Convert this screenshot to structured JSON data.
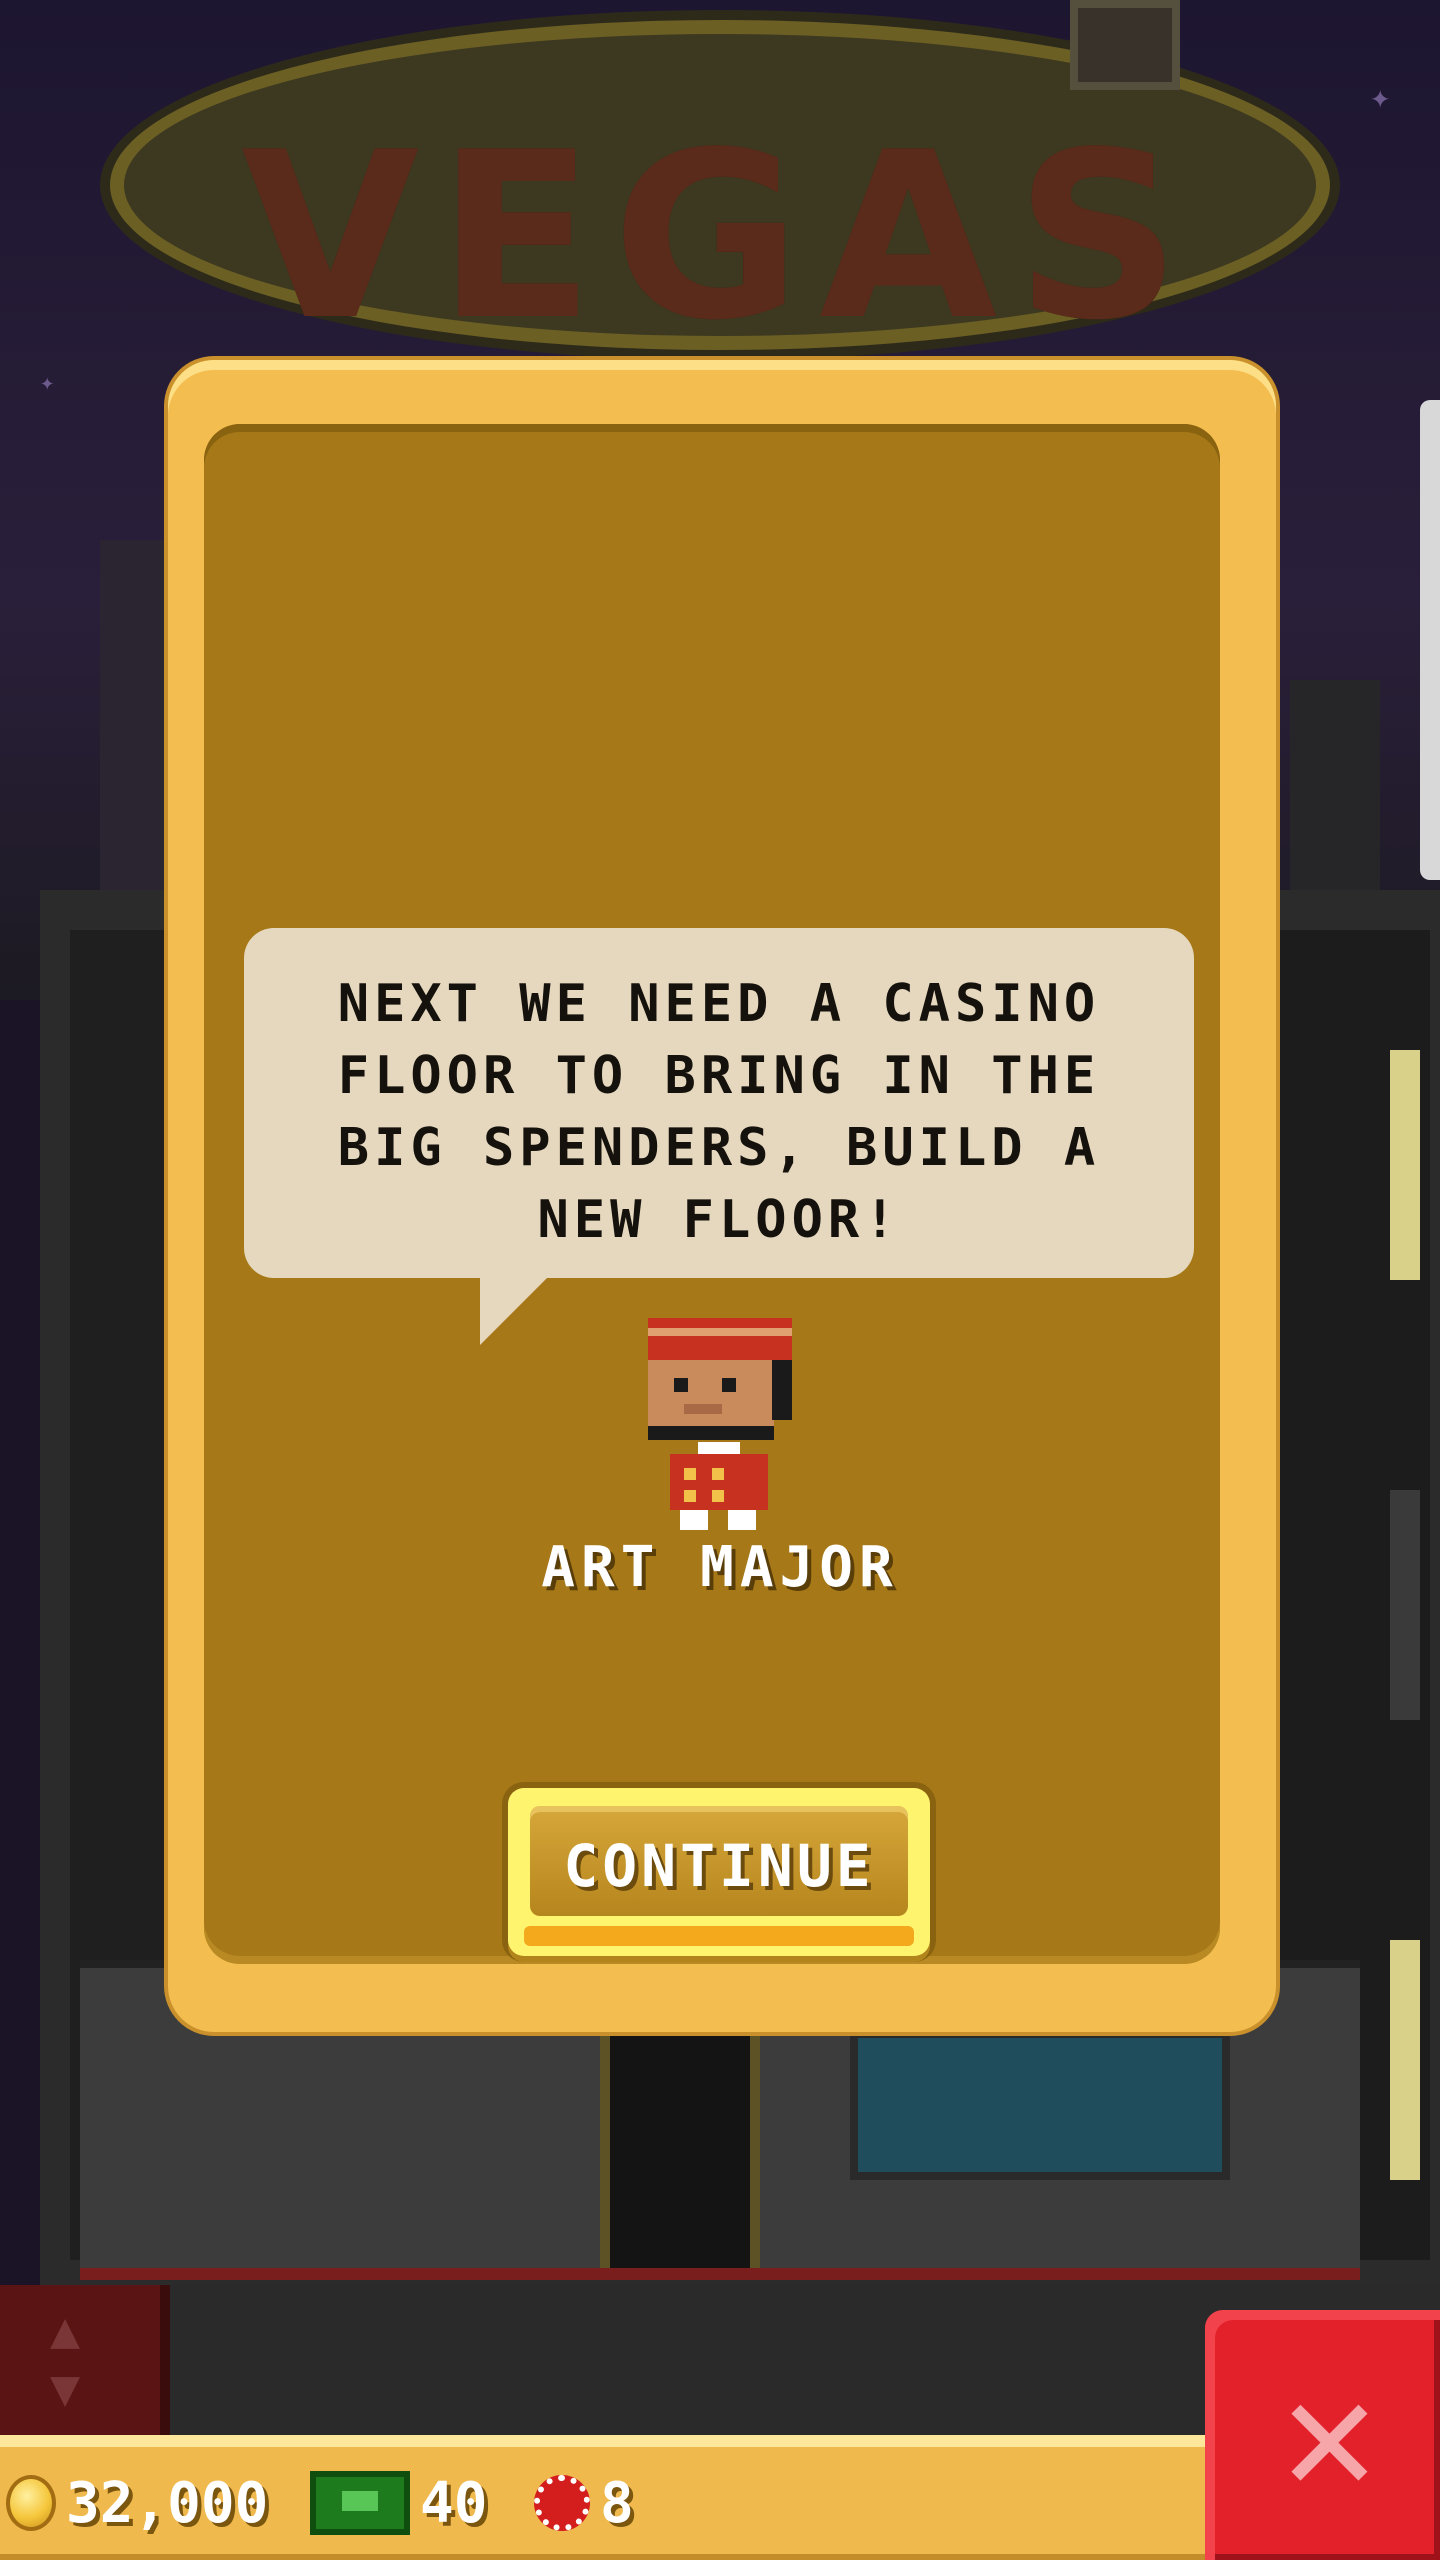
{
  "background": {
    "sign_text": "VEGAS"
  },
  "dialog": {
    "message": "NEXT WE NEED A CASINO FLOOR TO BRING IN THE BIG SPENDERS, BUILD A NEW FLOOR!",
    "character_name": "ART MAJOR",
    "continue_label": "CONTINUE"
  },
  "hud": {
    "coins": "32,000",
    "bux": "40",
    "chips": "8",
    "icons": {
      "coins": "coin-icon",
      "bux": "cash-icon",
      "chips": "casino-chip-icon",
      "elevator": "up-down-arrows-icon",
      "close": "close-icon"
    }
  },
  "colors": {
    "dialog_frame": "#f4bd50",
    "dialog_fill": "#a67817",
    "bubble": "#e5d8be",
    "close_button": "#e3212b"
  }
}
